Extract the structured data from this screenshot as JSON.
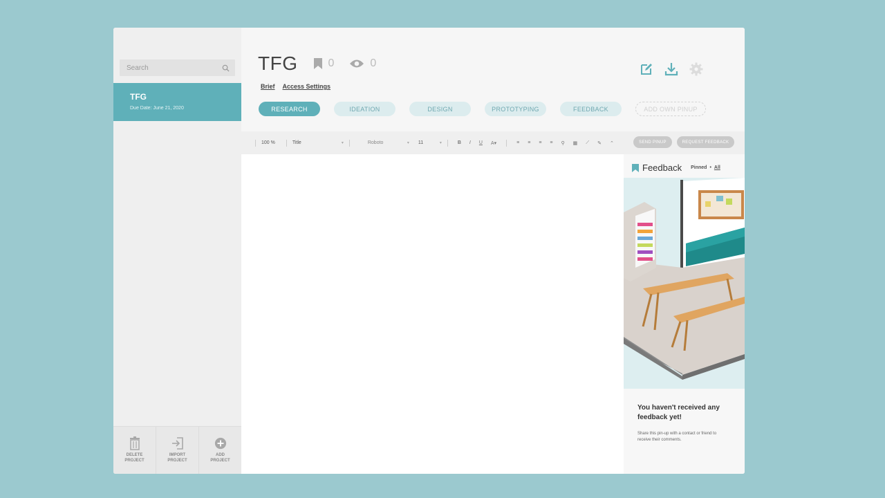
{
  "search": {
    "placeholder": "Search"
  },
  "project": {
    "name": "TFG",
    "due": "Due Date: June 21, 2020"
  },
  "footer": {
    "delete": "DELETE PROJECT",
    "import": "IMPORT PROJECT",
    "add": "ADD PROJECT"
  },
  "header": {
    "title": "TFG",
    "bookmarks": "0",
    "views": "0",
    "links": [
      "Brief",
      "Access Settings"
    ]
  },
  "tabs": [
    "RESEARCH",
    "IDEATION",
    "DESIGN",
    "PROTOTYPING",
    "FEEDBACK",
    "ADD OWN PINUP"
  ],
  "toolbar": {
    "zoom": "100 %",
    "style": "Title",
    "font": "Roboto",
    "size": "11",
    "send": "SEND PINUP",
    "request": "REQUEST FEEDBACK"
  },
  "feedback": {
    "title": "Feedback",
    "pinned": "Pinned",
    "dot": "•",
    "all": "All",
    "empty_title": "You haven't received any feedback yet!",
    "empty_text": "Share this pin-up with a contact or friend to receive their comments."
  },
  "colors": {
    "accent": "#5fb0b9",
    "background": "#9bc9cf"
  }
}
